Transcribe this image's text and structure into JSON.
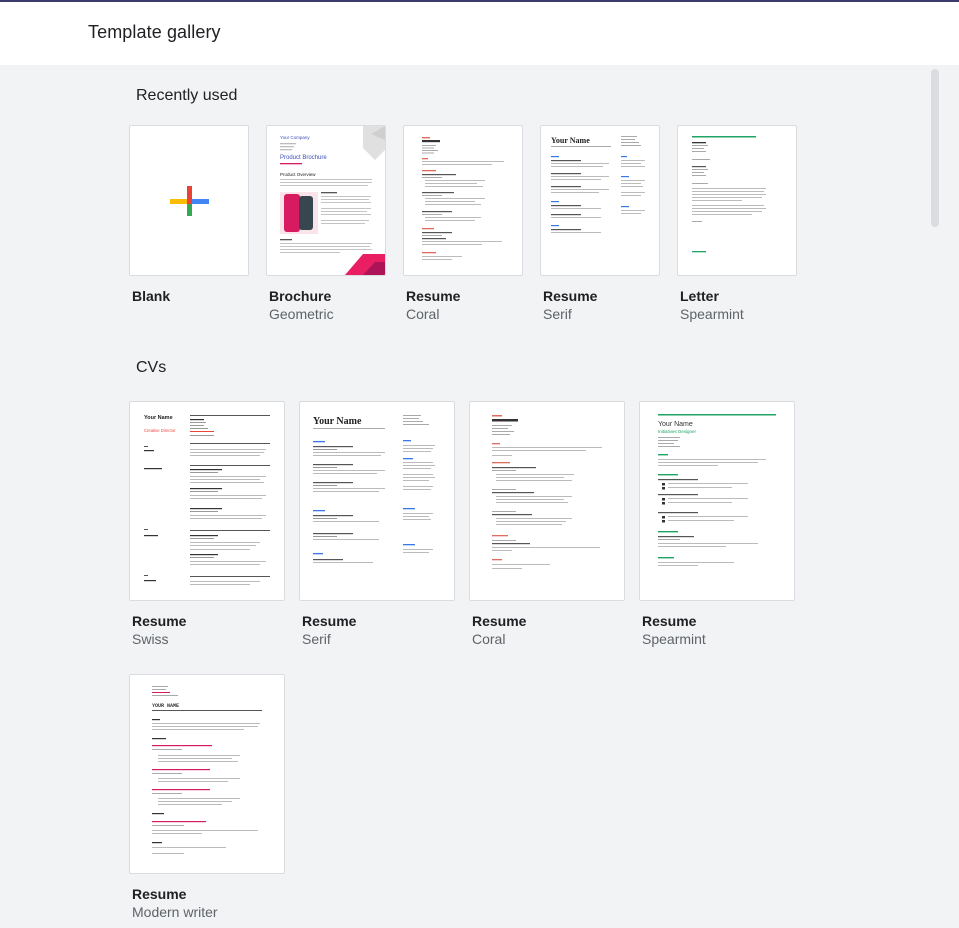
{
  "header": {
    "title": "Template gallery"
  },
  "sections": {
    "recently_used": {
      "title": "Recently used",
      "items": [
        {
          "name": "Blank",
          "subtitle": ""
        },
        {
          "name": "Brochure",
          "subtitle": "Geometric"
        },
        {
          "name": "Resume",
          "subtitle": "Coral"
        },
        {
          "name": "Resume",
          "subtitle": "Serif"
        },
        {
          "name": "Letter",
          "subtitle": "Spearmint"
        }
      ]
    },
    "cvs": {
      "title": "CVs",
      "items": [
        {
          "name": "Resume",
          "subtitle": "Swiss"
        },
        {
          "name": "Resume",
          "subtitle": "Serif"
        },
        {
          "name": "Resume",
          "subtitle": "Coral"
        },
        {
          "name": "Resume",
          "subtitle": "Spearmint"
        },
        {
          "name": "Resume",
          "subtitle": "Modern writer"
        }
      ]
    }
  },
  "thumbnail_text": {
    "brochure_company": "Your Company",
    "brochure_title": "Product Brochure",
    "brochure_overview": "Product Overview",
    "your_name": "Your Name",
    "your_name_caps": "YOUR NAME",
    "creative_director": "Creative Director",
    "initiatives_designer": "Initiatives Designer"
  },
  "colors": {
    "accent_blue": "#4285f4",
    "brochure_blue": "#3b4fb8",
    "coral": "#e06c5b",
    "spearmint": "#1fa463",
    "swiss_red": "#e8453c",
    "magenta": "#d81b60"
  }
}
